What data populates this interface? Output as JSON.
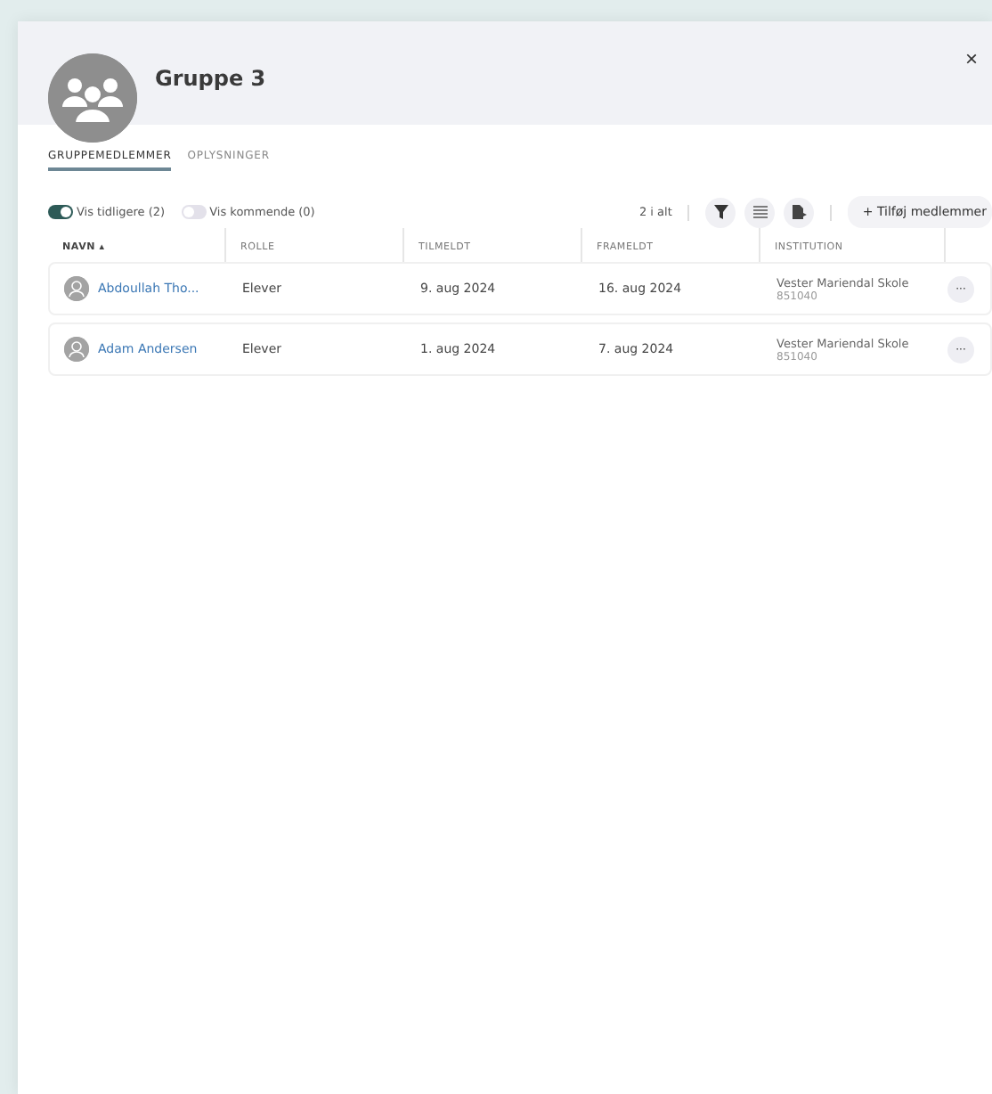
{
  "dialog": {
    "title": "Gruppe 3",
    "close": "×"
  },
  "tabs": [
    {
      "label": "GRUPPEMEDLEMMER",
      "selected": true
    },
    {
      "label": "OPLYSNINGER",
      "selected": false
    }
  ],
  "toggles": [
    {
      "label": "Vis tidligere (2)",
      "on": true
    },
    {
      "label": "Vis kommende (0)",
      "on": false
    }
  ],
  "toolbar": {
    "count": "2 i alt",
    "add_button": "+ Tilføj medlemmer"
  },
  "table": {
    "columns": [
      "NAVN ▴",
      "ROLLE",
      "TILMELDT",
      "FRAMELDT",
      "INSTITUTION"
    ],
    "rows": [
      {
        "name": "Abdoullah Tho...",
        "role": "Elever",
        "joined": "9. aug 2024",
        "left": "16. aug 2024",
        "institution": "Vester Mariendal Skole",
        "institution_code": "851040",
        "more": "···"
      },
      {
        "name": "Adam Andersen",
        "role": "Elever",
        "joined": "1. aug 2024",
        "left": "7. aug 2024",
        "institution": "Vester Mariendal Skole",
        "institution_code": "851040",
        "more": "···"
      }
    ]
  }
}
